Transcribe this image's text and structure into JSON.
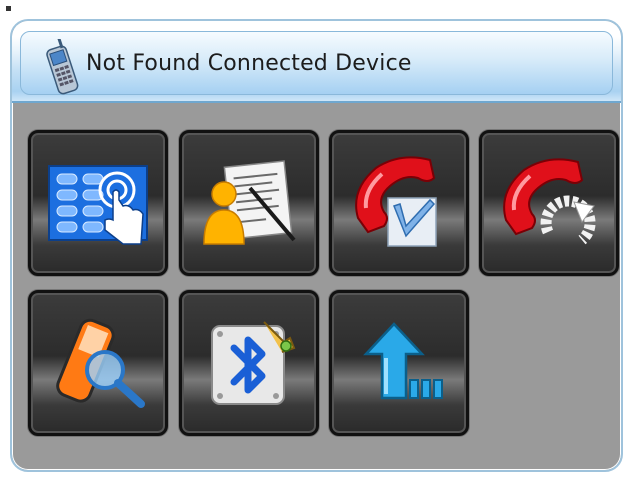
{
  "title": "Not Found Connected Device",
  "colors": {
    "frame_border": "#9fc3dc",
    "titlebar_blue": "#a9d2f1",
    "panel_gray": "#9a9a9a",
    "button_dark": "#2c2c2c"
  },
  "title_icon": "mobile-phone-icon",
  "buttons": [
    {
      "icon": "dial-pad-icon"
    },
    {
      "icon": "phonebook-icon"
    },
    {
      "icon": "call-history-icon"
    },
    {
      "icon": "redial-icon"
    },
    {
      "icon": "search-device-icon"
    },
    {
      "icon": "bluetooth-settings-icon"
    },
    {
      "icon": "exit-icon"
    }
  ]
}
